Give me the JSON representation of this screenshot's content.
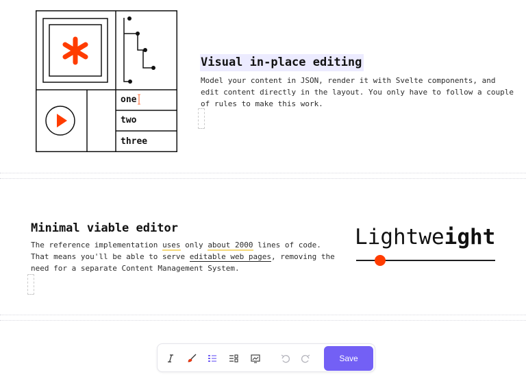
{
  "illustration": {
    "list_items": [
      "one",
      "two",
      "three"
    ],
    "accent_color": "#ff3c00"
  },
  "section1": {
    "heading": "Visual in-place editing",
    "body": "Model your content in JSON, render it with Svelte components, and edit content directly in the layout. You only have to follow a couple of rules to make this work.",
    "heading_highlight_color": "#ecebff"
  },
  "section2": {
    "heading": "Minimal viable editor",
    "body_part1": "The reference implementation ",
    "body_uses": "uses",
    "body_part2": " only ",
    "body_lines": "about 2000",
    "body_part3": " lines of code. That means you'll be able to serve ",
    "body_link": "editable web pages",
    "body_part4": ", removing the need for a separate Content Management System."
  },
  "lightweight": {
    "word_thin": "Lightwe",
    "word_bold": "ight",
    "slider_value": 0.17,
    "thumb_color": "#ff3c00"
  },
  "toolbar": {
    "icons": [
      "italic-icon",
      "brush-icon",
      "list-icon",
      "insert-icon",
      "image-icon",
      "undo-icon",
      "redo-icon"
    ],
    "save_label": "Save",
    "save_color": "#7360f5"
  }
}
